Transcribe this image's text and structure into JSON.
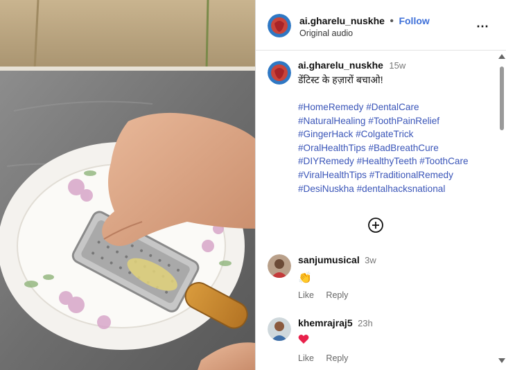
{
  "post": {
    "username": "ai.gharelu_nuskhe",
    "separator": "•",
    "follow_label": "Follow",
    "audio": "Original audio",
    "more_icon": "⋯"
  },
  "caption": {
    "username": "ai.gharelu_nuskhe",
    "time": "15w",
    "text": "डेंटिस्ट के हज़ारों बचाओ!",
    "hashtag_lines": [
      "#HomeRemedy #DentalCare",
      "#NaturalHealing #ToothPainRelief",
      "#GingerHack #ColgateTrick",
      "#OralHealthTips #BadBreathCure",
      "#DIYRemedy #HealthyTeeth #ToothCare",
      "#ViralHealthTips #TraditionalRemedy",
      "#DesiNuskha #dentalhacksnational"
    ],
    "load_more_icon": "plus-circle-icon"
  },
  "comments": [
    {
      "username": "sanjumusical",
      "time": "3w",
      "emoji": "👏",
      "like_label": "Like",
      "reply_label": "Reply"
    },
    {
      "username": "khemrajraj5",
      "time": "23h",
      "emoji": "❤️",
      "like_label": "Like",
      "reply_label": "Reply"
    }
  ],
  "colors": {
    "link": "#3a55b8",
    "follow": "#3d6fd8",
    "heart": "#e8214b"
  }
}
